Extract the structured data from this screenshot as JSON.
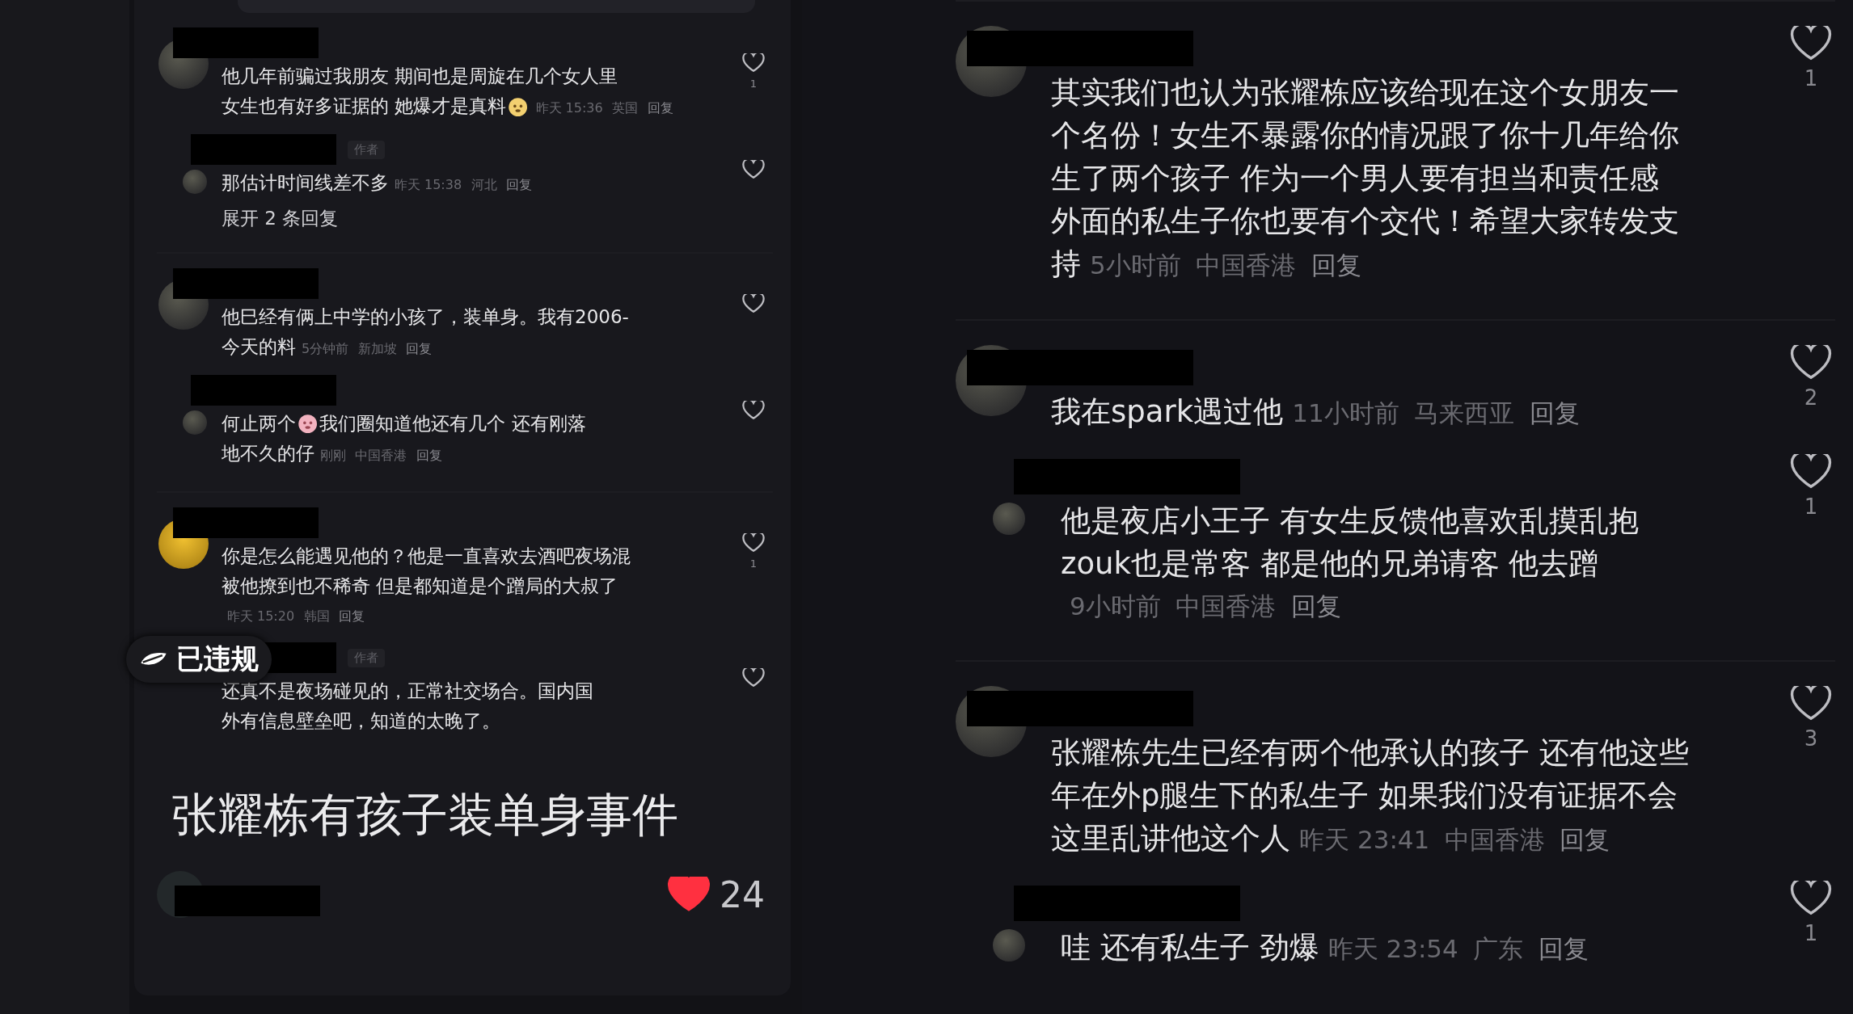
{
  "left_panel": {
    "comments": [
      {
        "lines": [
          [
            {
              "kind": "text",
              "text": "他几年前骗过我朋友 期间也是周旋在几个女人里"
            }
          ],
          [
            {
              "kind": "text",
              "text": "女生也有好多证据的 她爆才是真料"
            },
            {
              "kind": "emoji"
            }
          ]
        ],
        "meta": {
          "time": "昨天 15:36",
          "location": "英国",
          "reply": "回复"
        },
        "likes": "1",
        "replies": [
          {
            "author_tag": "作者",
            "lines": [
              [
                {
                  "kind": "text",
                  "text": "那估计时间线差不多"
                }
              ]
            ],
            "meta": {
              "time": "昨天 15:38",
              "location": "河北",
              "reply": "回复"
            }
          }
        ],
        "expand_link": "展开 2 条回复"
      },
      {
        "lines": [
          [
            {
              "kind": "text",
              "text": "他巳经有俩上中学的小孩了，装单身。我有2006-"
            }
          ],
          [
            {
              "kind": "text",
              "text": "今天的料"
            }
          ]
        ],
        "meta": {
          "time": "5分钟前",
          "location": "新加坡",
          "reply": "回复"
        },
        "replies": [
          {
            "lines": [
              [
                {
                  "kind": "text",
                  "text": "何止两个"
                },
                {
                  "kind": "emoji"
                },
                {
                  "kind": "text",
                  "text": "我们圈知道他还有几个 还有刚落"
                }
              ],
              [
                {
                  "kind": "text",
                  "text": "地不久的仔"
                }
              ]
            ],
            "meta": {
              "time": "刚刚",
              "location": "中国香港",
              "reply": "回复"
            }
          }
        ]
      },
      {
        "lines": [
          [
            {
              "kind": "text",
              "text": "你是怎么能遇见他的？他是一直喜欢去酒吧夜场混"
            }
          ],
          [
            {
              "kind": "text",
              "text": "被他撩到也不稀奇 但是都知道是个蹭局的大叔了"
            }
          ]
        ],
        "meta": {
          "time": "昨天 15:20",
          "location": "韩国",
          "reply": "回复"
        },
        "likes": "1",
        "replies": [
          {
            "author_tag": "作者",
            "violation_badge": "已违规",
            "lines": [
              [
                {
                  "kind": "text",
                  "text": "还真不是夜场碰见的，正常社交场合。国内国"
                }
              ],
              [
                {
                  "kind": "text",
                  "text": "外有信息壁垒吧，知道的太晚了。"
                }
              ]
            ]
          }
        ]
      }
    ],
    "post_title": "张耀栋有孩子装单身事件",
    "post_likes": "24",
    "post_liked": true
  },
  "right_panel": {
    "comments": [
      {
        "lines": [
          [
            {
              "kind": "text",
              "text": "其实我们也认为张耀栋应该给现在这个女朋友一"
            }
          ],
          [
            {
              "kind": "text",
              "text": "个名份！女生不暴露你的情况跟了你十几年给你"
            }
          ],
          [
            {
              "kind": "text",
              "text": "生了两个孩子 作为一个男人要有担当和责任感"
            }
          ],
          [
            {
              "kind": "text",
              "text": "外面的私生子你也要有个交代！希望大家转发支"
            }
          ],
          [
            {
              "kind": "text",
              "text": "持"
            }
          ]
        ],
        "meta": {
          "time": "5小时前",
          "location": "中国香港",
          "reply": "回复"
        },
        "likes": "1"
      },
      {
        "lines": [
          [
            {
              "kind": "text",
              "text": "我在spark遇过他"
            }
          ]
        ],
        "meta": {
          "time": "11小时前",
          "location": "马来西亚",
          "reply": "回复"
        },
        "likes": "2",
        "replies": [
          {
            "lines": [
              [
                {
                  "kind": "text",
                  "text": "他是夜店小王子 有女生反馈他喜欢乱摸乱抱"
                }
              ],
              [
                {
                  "kind": "text",
                  "text": "zouk也是常客 都是他的兄弟请客 他去蹭"
                }
              ]
            ],
            "meta": {
              "time": "9小时前",
              "location": "中国香港",
              "reply": "回复"
            },
            "likes": "1"
          }
        ]
      },
      {
        "lines": [
          [
            {
              "kind": "text",
              "text": "张耀栋先生已经有两个他承认的孩子 还有他这些"
            }
          ],
          [
            {
              "kind": "text",
              "text": "年在外p腿生下的私生子 如果我们没有证据不会"
            }
          ],
          [
            {
              "kind": "text",
              "text": "这里乱讲他这个人"
            }
          ]
        ],
        "meta": {
          "time": "昨天 23:41",
          "location": "中国香港",
          "reply": "回复"
        },
        "likes": "3",
        "replies": [
          {
            "lines": [
              [
                {
                  "kind": "text",
                  "text": "哇 还有私生子 劲爆"
                }
              ]
            ],
            "meta": {
              "time": "昨天 23:54",
              "location": "广东",
              "reply": "回复"
            },
            "likes": "1"
          }
        ]
      }
    ]
  }
}
